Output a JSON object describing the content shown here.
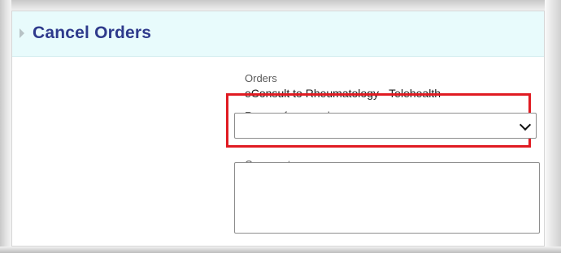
{
  "header": {
    "title": "Cancel Orders"
  },
  "form": {
    "orders_label": "Orders",
    "orders_value": "eConsult to Rheumatology - Telehealth",
    "reason_label": "Reason for cancel",
    "reason_selected": "",
    "comments_label": "Comments",
    "comments_value": ""
  },
  "colors": {
    "header_bg": "#e8fbfc",
    "title": "#2e3a8c",
    "highlight": "#e01b22"
  },
  "icons": {
    "header_expander": "triangle-right-icon",
    "select_caret": "chevron-down-icon"
  }
}
